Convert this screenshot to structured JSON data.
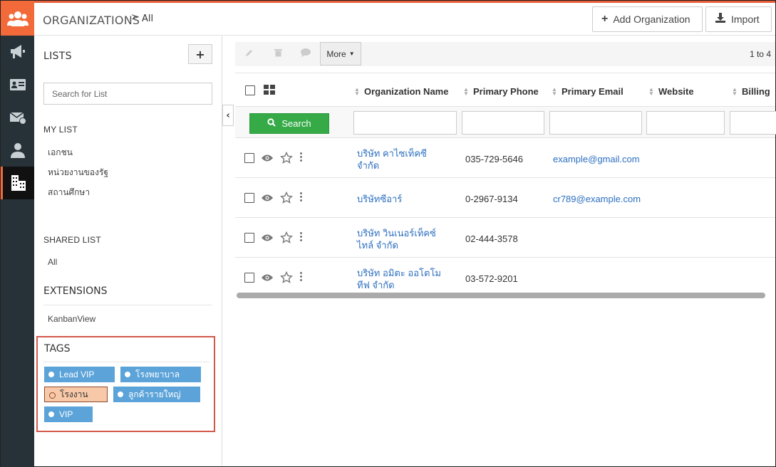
{
  "header": {
    "breadcrumb_main": "ORGANIZATIONS",
    "breadcrumb_sep": ">",
    "breadcrumb_sub": "All",
    "add_label": "Add Organization",
    "import_label": "Import"
  },
  "rail": {
    "icons": [
      "users-icon",
      "megaphone-icon",
      "contact-card-icon",
      "mail-icon",
      "person-icon",
      "building-icon"
    ]
  },
  "sidebar": {
    "lists_title": "LISTS",
    "add_list": "+",
    "search_placeholder": "Search for List",
    "my_list_title": "MY LIST",
    "my_list": [
      "เอกชน",
      "หน่วยงานของรัฐ",
      "สถานศึกษา"
    ],
    "shared_list_title": "SHARED LIST",
    "shared_list": [
      "All"
    ],
    "extensions_title": "EXTENSIONS",
    "extensions": [
      "KanbanView"
    ],
    "tags_title": "TAGS",
    "tags": [
      "Lead VIP",
      "โรงพยาบาล",
      "โรงงาน",
      "ลูกค้ารายใหญ่",
      "VIP"
    ]
  },
  "toolbar": {
    "more_label": "More",
    "paging": "1 to 4"
  },
  "grid": {
    "columns": [
      "Organization Name",
      "Primary Phone",
      "Primary Email",
      "Website",
      "Billing"
    ],
    "search_label": "Search",
    "rows": [
      {
        "name_line1": "บริษัท คาไซเท็คซี",
        "name_line2": "จำกัด",
        "phone": "035-729-5646",
        "email": "example@gmail.com"
      },
      {
        "name_line1": "บริษัทซีอาร์",
        "name_line2": "",
        "phone": "0-2967-9134",
        "email": "cr789@example.com"
      },
      {
        "name_line1": "บริษัท วินเนอร์เท็คซ์",
        "name_line2": "ไทล์ จำกัด",
        "phone": "02-444-3578",
        "email": ""
      },
      {
        "name_line1": "บริษัท อมิตะ ออโตโม",
        "name_line2": "ทีฟ จำกัด",
        "phone": "03-572-9201",
        "email": ""
      }
    ]
  }
}
